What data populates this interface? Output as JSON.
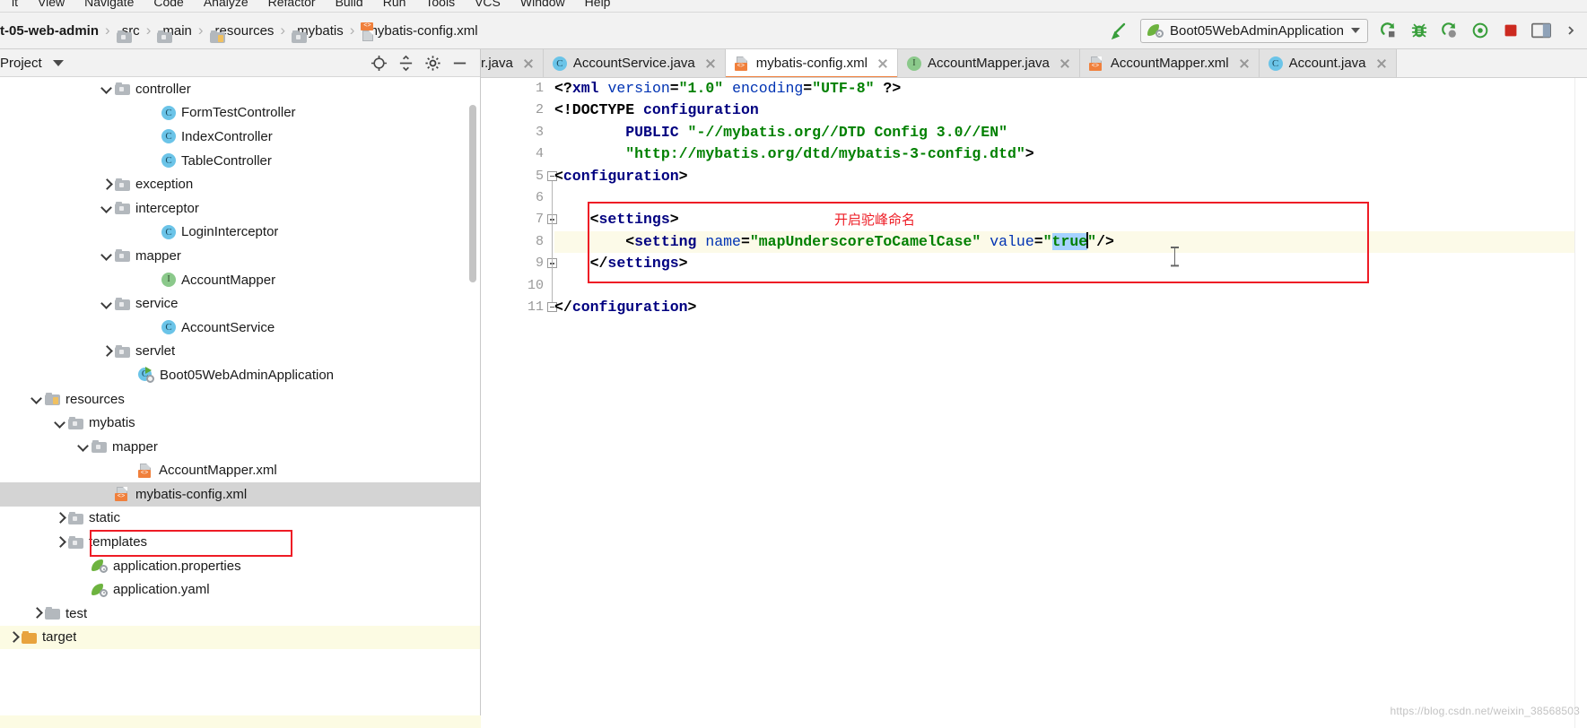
{
  "menubar": {
    "items": [
      "it",
      "View",
      "Navigate",
      "Code",
      "Analyze",
      "Refactor",
      "Build",
      "Run",
      "Tools",
      "VCS",
      "Window",
      "Help"
    ]
  },
  "breadcrumb": {
    "items": [
      {
        "label": "t-05-web-admin",
        "icon": "none"
      },
      {
        "label": "src",
        "icon": "folder-icon"
      },
      {
        "label": "main",
        "icon": "folder-icon"
      },
      {
        "label": "resources",
        "icon": "resources-folder-icon"
      },
      {
        "label": "mybatis",
        "icon": "folder-icon"
      },
      {
        "label": "mybatis-config.xml",
        "icon": "xml-file-icon"
      }
    ],
    "separator": "›"
  },
  "toolbar": {
    "build_icon": "hammer-icon",
    "run_configuration": "Boot05WebAdminApplication",
    "run_config_icon": "spring-boot-icon",
    "dropdown_icon": "chevron-down-icon",
    "buttons": [
      {
        "name": "rerun-icon",
        "label": "↻"
      },
      {
        "name": "debug-icon",
        "label": "🐞"
      },
      {
        "name": "run-with-coverage-icon",
        "label": "▶"
      },
      {
        "name": "profiler-icon",
        "label": "◎"
      },
      {
        "name": "stop-icon",
        "label": "■"
      },
      {
        "name": "layout-icon",
        "label": "▤"
      }
    ],
    "stop_color": "#cc2a20",
    "accent_green": "#389e3b"
  },
  "project_panel": {
    "title": "Project",
    "dropdown_icon": "chevron-down-icon",
    "header_icons": [
      "locate-icon",
      "collapse-all-icon",
      "settings-gear-icon",
      "hide-icon"
    ],
    "tree": [
      {
        "label": "controller",
        "indent": 4,
        "arrow": "down",
        "icon": "folder-icon"
      },
      {
        "label": "FormTestController",
        "indent": 6,
        "arrow": "none",
        "icon": "class-icon"
      },
      {
        "label": "IndexController",
        "indent": 6,
        "arrow": "none",
        "icon": "class-icon"
      },
      {
        "label": "TableController",
        "indent": 6,
        "arrow": "none",
        "icon": "class-icon"
      },
      {
        "label": "exception",
        "indent": 4,
        "arrow": "right",
        "icon": "folder-icon"
      },
      {
        "label": "interceptor",
        "indent": 4,
        "arrow": "down",
        "icon": "folder-icon"
      },
      {
        "label": "LoginInterceptor",
        "indent": 6,
        "arrow": "none",
        "icon": "class-icon"
      },
      {
        "label": "mapper",
        "indent": 4,
        "arrow": "down",
        "icon": "folder-icon"
      },
      {
        "label": "AccountMapper",
        "indent": 6,
        "arrow": "none",
        "icon": "interface-icon"
      },
      {
        "label": "service",
        "indent": 4,
        "arrow": "down",
        "icon": "folder-icon"
      },
      {
        "label": "AccountService",
        "indent": 6,
        "arrow": "none",
        "icon": "class-icon"
      },
      {
        "label": "servlet",
        "indent": 4,
        "arrow": "right",
        "icon": "folder-icon"
      },
      {
        "label": "Boot05WebAdminApplication",
        "indent": 5,
        "arrow": "none",
        "icon": "spring-app-class-icon"
      },
      {
        "label": "resources",
        "indent": 1,
        "arrow": "down",
        "icon": "resources-folder-icon"
      },
      {
        "label": "mybatis",
        "indent": 2,
        "arrow": "down",
        "icon": "folder-icon"
      },
      {
        "label": "mapper",
        "indent": 3,
        "arrow": "down",
        "icon": "folder-icon"
      },
      {
        "label": "AccountMapper.xml",
        "indent": 5,
        "arrow": "none",
        "icon": "xml-file-icon"
      },
      {
        "label": "mybatis-config.xml",
        "indent": 4,
        "arrow": "none",
        "icon": "xml-file-icon",
        "selected": true,
        "highlighted": true
      },
      {
        "label": "static",
        "indent": 2,
        "arrow": "right",
        "icon": "folder-icon"
      },
      {
        "label": "templates",
        "indent": 2,
        "arrow": "right",
        "icon": "folder-icon"
      },
      {
        "label": "application.properties",
        "indent": 3,
        "arrow": "none",
        "icon": "spring-config-icon"
      },
      {
        "label": "application.yaml",
        "indent": 3,
        "arrow": "none",
        "icon": "spring-config-icon"
      },
      {
        "label": "test",
        "indent": 1,
        "arrow": "right",
        "icon": "folder-plain-icon"
      },
      {
        "label": "target",
        "indent": 0,
        "arrow": "right",
        "icon": "folder-orange-icon",
        "target": true
      }
    ]
  },
  "editor": {
    "tabs": [
      {
        "label": "r.java",
        "icon": "none",
        "active": false,
        "clipped": true
      },
      {
        "label": "AccountService.java",
        "icon": "class-icon",
        "active": false
      },
      {
        "label": "mybatis-config.xml",
        "icon": "xml-file-icon",
        "active": true
      },
      {
        "label": "AccountMapper.java",
        "icon": "interface-icon",
        "active": false
      },
      {
        "label": "AccountMapper.xml",
        "icon": "xml-file-icon",
        "active": false
      },
      {
        "label": "Account.java",
        "icon": "class-icon",
        "active": false
      }
    ],
    "line_numbers": [
      1,
      2,
      3,
      4,
      5,
      6,
      7,
      8,
      9,
      10,
      11
    ],
    "code_lines": [
      {
        "n": 1,
        "text": "<?xml version=\"1.0\" encoding=\"UTF-8\" ?>"
      },
      {
        "n": 2,
        "text": "<!DOCTYPE configuration"
      },
      {
        "n": 3,
        "text": "        PUBLIC \"-//mybatis.org//DTD Config 3.0//EN\""
      },
      {
        "n": 4,
        "text": "        \"http://mybatis.org/dtd/mybatis-3-config.dtd\">"
      },
      {
        "n": 5,
        "text": "<configuration>"
      },
      {
        "n": 6,
        "text": ""
      },
      {
        "n": 7,
        "text": "    <settings>"
      },
      {
        "n": 8,
        "text": "        <setting name=\"mapUnderscoreToCamelCase\" value=\"true\"/>"
      },
      {
        "n": 9,
        "text": "    </settings>"
      },
      {
        "n": 10,
        "text": ""
      },
      {
        "n": 11,
        "text": "</configuration>"
      }
    ],
    "annotation_note": "开启驼峰命名",
    "annotation_color": "#ee1c25",
    "current_line": 8,
    "caret_position": "line 8, after \"true\""
  },
  "watermark": "https://blog.csdn.net/weixin_38568503"
}
